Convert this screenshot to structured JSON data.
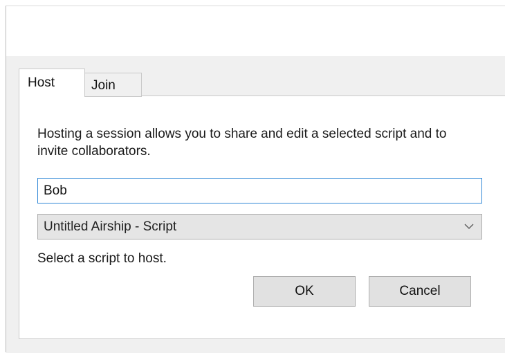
{
  "tabs": {
    "host_label": "Host",
    "join_label": "Join"
  },
  "host_panel": {
    "description": "Hosting a session allows you to share and edit a selected script and to invite collaborators.",
    "name_input_value": "Bob",
    "script_select_value": "Untitled Airship - Script",
    "hint": "Select a script to host.",
    "ok_label": "OK",
    "cancel_label": "Cancel"
  },
  "icons": {
    "select_arrow": "chevron-down-icon"
  },
  "colors": {
    "focus_border": "#2f87d6",
    "button_bg": "#e1e1e1",
    "panel_bg": "#f0f0f0"
  }
}
